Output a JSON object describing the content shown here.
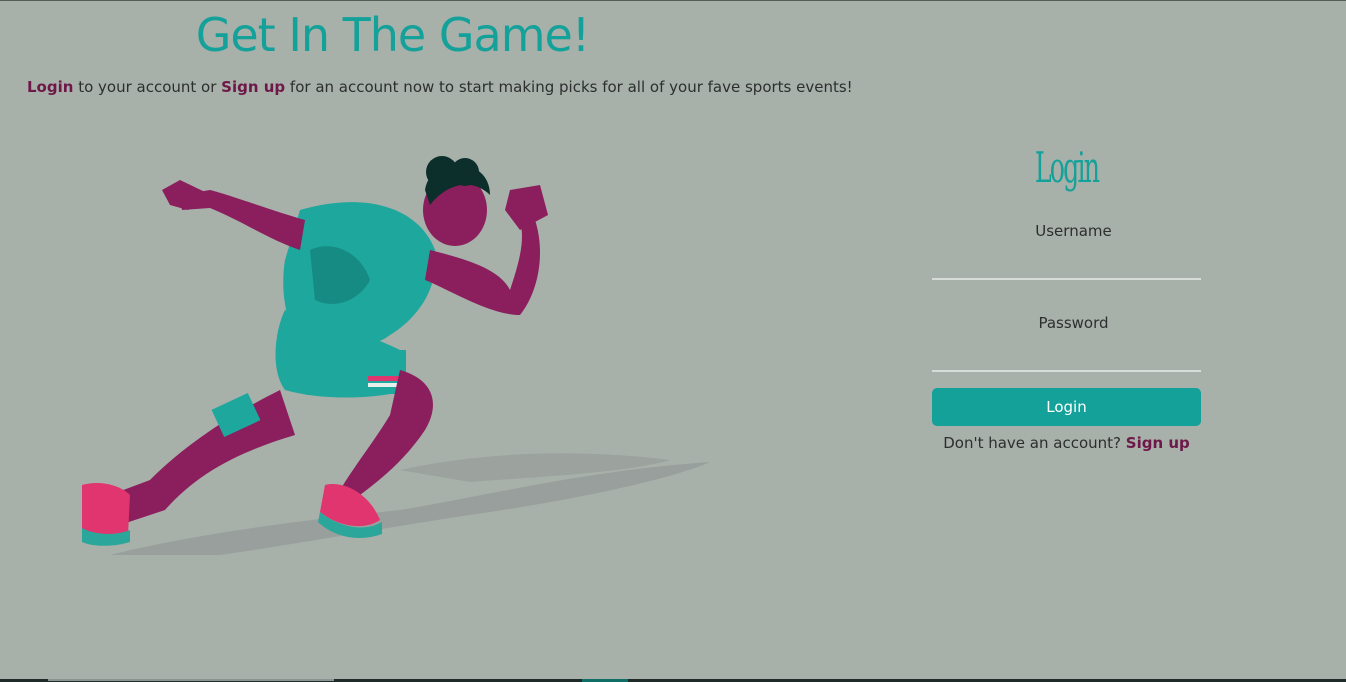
{
  "hero": {
    "title": "Get In The Game!",
    "intro_login_link": "Login",
    "intro_text_1": " to your account or ",
    "intro_signup_link": "Sign up",
    "intro_text_2": " for an account now to start making picks for all of your fave sports events!"
  },
  "illustration": {
    "icon": "sprinter-illustration"
  },
  "login_form": {
    "title": "Login",
    "username_label": "Username",
    "username_value": "",
    "password_label": "Password",
    "password_value": "",
    "submit_label": "Login",
    "signup_prompt": "Don't have an account?",
    "signup_link": "Sign up"
  },
  "colors": {
    "background": "#a8b0aa",
    "accent": "#14a199",
    "link": "#6d1848",
    "text": "#2c2f2e"
  }
}
